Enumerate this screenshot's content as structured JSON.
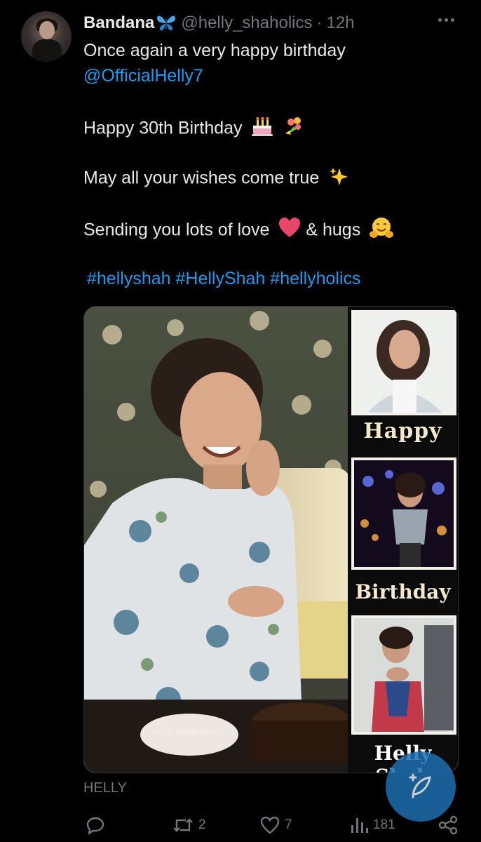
{
  "tweet": {
    "author": {
      "display_name": "Bandana",
      "display_emoji": "butterfly",
      "handle": "@helly_shaholics",
      "time": "12h"
    },
    "more_menu_icon": "more-horizontal-icon",
    "body": {
      "line1": "Once again a very happy birthday",
      "mention": "@OfficialHelly7",
      "line3": "Happy 30th Birthday",
      "line3_emojis": [
        "birthday-cake",
        "bouquet"
      ],
      "line4": "May all your wishes come true",
      "line4_emoji": "sparkles",
      "line5": "Sending you lots of love",
      "line5_emoji": "heart",
      "line5b": "& hugs",
      "line5b_emoji": "hugging-face",
      "hashtags": [
        "#hellyshah",
        "#HellyShah",
        "#hellyholics"
      ]
    },
    "media": {
      "captions": [
        "Happy",
        "Birthday",
        "Helly Shah"
      ],
      "watermark": "helly_shahholics"
    },
    "media_label": "HELLY",
    "actions": {
      "reply_icon": "reply-icon",
      "retweet_icon": "retweet-icon",
      "retweet_count": "2",
      "like_icon": "heart-icon",
      "like_count": "7",
      "views_icon": "views-icon",
      "views_count": "181",
      "share_icon": "share-icon"
    },
    "compose_button_icon": "compose-feather-icon"
  },
  "colors": {
    "background": "#000000",
    "text": "#e7e9ea",
    "muted": "#71767b",
    "accent": "#1d9bf0"
  }
}
